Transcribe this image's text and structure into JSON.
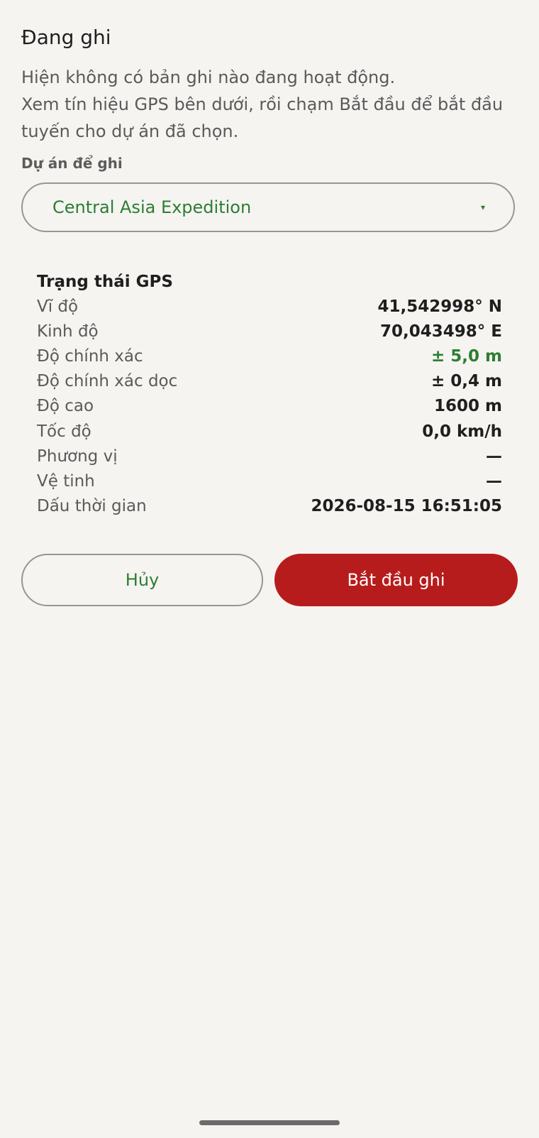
{
  "header": {
    "title": "Đang ghi"
  },
  "description": {
    "line1": "Hiện không có bản ghi nào đang hoạt động.",
    "line2": "Xem tín hiệu GPS bên dưới, rồi chạm Bắt đầu để bắt đầu",
    "line3": "tuyến cho dự án đã chọn."
  },
  "project": {
    "label": "Dự án để ghi",
    "selected": "Central Asia Expedition",
    "chevron": "▾",
    "chevron_icon": "chevron-down-icon"
  },
  "gps": {
    "title": "Trạng thái GPS",
    "rows": [
      {
        "label": "Vĩ độ",
        "value": "41,542998° N"
      },
      {
        "label": "Kinh độ",
        "value": "70,043498° E"
      },
      {
        "label": "Độ chính xác",
        "value": "± 5,0 m"
      },
      {
        "label": "Độ chính xác dọc",
        "value": "± 0,4 m"
      },
      {
        "label": "Độ cao",
        "value": "1600 m"
      },
      {
        "label": "Tốc độ",
        "value": "0,0 km/h"
      },
      {
        "label": "Phương vị",
        "value": "—"
      },
      {
        "label": "Vệ tinh",
        "value": "—"
      },
      {
        "label": "Dấu thời gian",
        "value": "2026-08-15 16:51:05"
      }
    ]
  },
  "actions": {
    "cancel_label": "Hủy",
    "start_label": "Bắt đầu ghi"
  },
  "colors": {
    "accent": "#2e7d32",
    "primary_button": "#b71c1c",
    "background": "#f5f4f1"
  }
}
